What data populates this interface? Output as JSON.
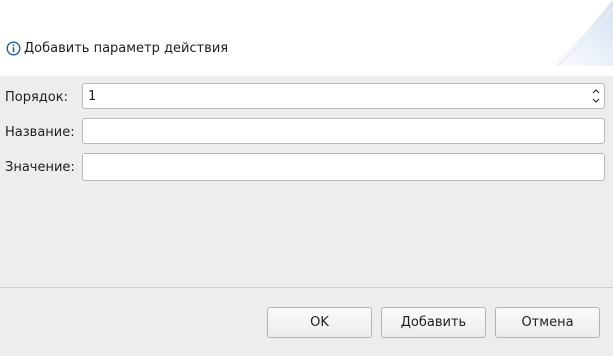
{
  "dialog": {
    "title": "Добавить параметр действия",
    "title_icon": "info-icon"
  },
  "form": {
    "order": {
      "label": "Порядок:",
      "value": "1"
    },
    "name": {
      "label": "Название:",
      "value": ""
    },
    "value": {
      "label": "Значение:",
      "value": ""
    }
  },
  "buttons": {
    "ok": "OK",
    "add": "Добавить",
    "cancel": "Отмена"
  },
  "colors": {
    "background": "#ededed",
    "header": "#ffffff",
    "icon_accent": "#1f5fa8"
  }
}
